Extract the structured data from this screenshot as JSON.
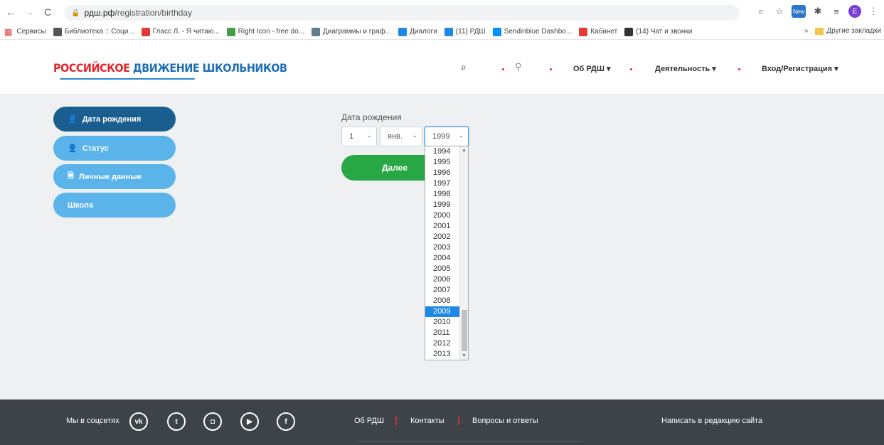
{
  "browser": {
    "url_host": "рдш.рф",
    "url_path": "/registration/birthday",
    "profile_letter": "E",
    "ext_label": "New",
    "bookmarks": [
      {
        "label": "Сервисы",
        "color": "#e53935"
      },
      {
        "label": "Библиотека :: Соци...",
        "color": "#555555"
      },
      {
        "label": "Гласс Л. - Я читаю...",
        "color": "#e53935"
      },
      {
        "label": "Right Icon - free do...",
        "color": "#43a047"
      },
      {
        "label": "Диаграммы и граф...",
        "color": "#607d8b"
      },
      {
        "label": "Диалоги",
        "color": "#1e88e5"
      },
      {
        "label": "(11) РДШ",
        "color": "#1e88e5"
      },
      {
        "label": "Sendinblue Dashbo...",
        "color": "#0092ff"
      },
      {
        "label": "Кабинет",
        "color": "#e53935"
      },
      {
        "label": "(14) Чат и звонки",
        "color": "#333333"
      }
    ],
    "more_bookmarks": "»",
    "other_bookmarks": "Другие закладки"
  },
  "header": {
    "logo_part1": "РОССИЙСКОЕ",
    "logo_part2": "ДВИЖЕНИЕ ШКОЛЬНИКОВ",
    "nav": {
      "about": "Об РДШ ▾",
      "activity": "Деятельность ▾",
      "login": "Вход/Регистрация ▾"
    }
  },
  "sidebar": {
    "items": [
      {
        "label": "Дата рождения",
        "icon": "👤"
      },
      {
        "label": "Статус",
        "icon": "👤"
      },
      {
        "label": "Личные данные",
        "icon": "🗎"
      },
      {
        "label": "Школа",
        "icon": ""
      }
    ]
  },
  "form": {
    "label": "Дата рождения",
    "day": "1",
    "month": "янв.",
    "year": "1999",
    "next_label": "Далее"
  },
  "year_dropdown": {
    "options": [
      "1994",
      "1995",
      "1996",
      "1997",
      "1998",
      "1999",
      "2000",
      "2001",
      "2002",
      "2003",
      "2004",
      "2005",
      "2006",
      "2007",
      "2008",
      "2009",
      "2010",
      "2011",
      "2012",
      "2013"
    ],
    "highlighted": "2009"
  },
  "footer": {
    "social_label": "Мы в соцсетях",
    "social": [
      "vk",
      "twitter",
      "instagram",
      "youtube",
      "facebook"
    ],
    "links": [
      "Об РДШ",
      "Контакты",
      "Вопросы и ответы"
    ],
    "write_link": "Написать в редакцию сайта"
  },
  "colors": {
    "sidebar_active": "#1a5e8f",
    "sidebar_item": "#5ab4ea",
    "next_button": "#28a745",
    "footer_bg": "#3d4348",
    "highlight": "#1e88e5"
  }
}
